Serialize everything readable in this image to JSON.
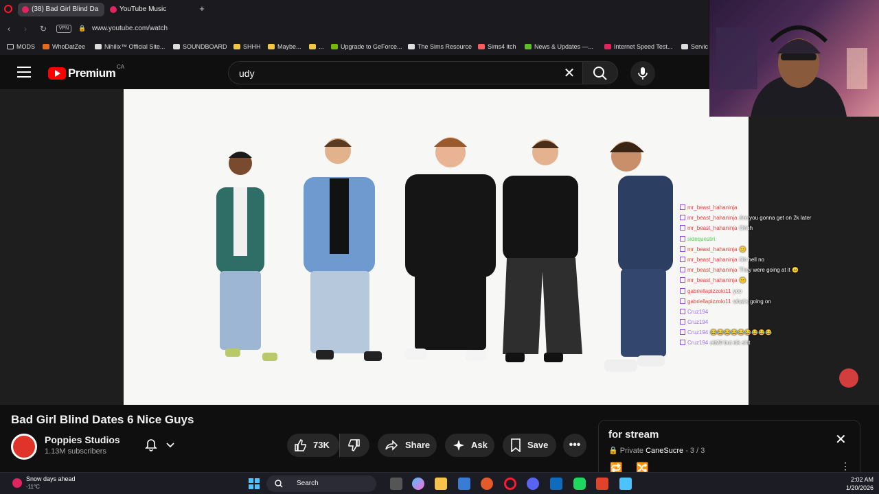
{
  "browser": {
    "tabs": [
      {
        "label": "(38) Bad Girl Blind Da"
      },
      {
        "label": "YouTube Music"
      }
    ],
    "url": "www.youtube.com/watch",
    "vpn_label": "VPN",
    "bookmarks": [
      "MODS",
      "WhoDatZee",
      "Nihilix™ Official Site...",
      "SOUNDBOARD",
      "SHHH",
      "Maybe...",
      "...",
      "Upgrade to GeForce...",
      "The Sims Resource",
      "Sims4 itch",
      "News & Updates —...",
      "Internet Speed Test...",
      "Servic"
    ]
  },
  "header": {
    "brand": "Premium",
    "country": "CA",
    "search_value": "udy"
  },
  "chat": [
    {
      "user": "mr_beast_hahaninja",
      "msg": "",
      "color": "#e8423f"
    },
    {
      "user": "mr_beast_hahaninja",
      "msg": "Are you gonna get on 2k later",
      "color": "#e8423f"
    },
    {
      "user": "mr_beast_hahaninja",
      "msg": "Ohhh",
      "color": "#e8423f"
    },
    {
      "user": "sidequestiri",
      "msg": "",
      "color": "#4fd14f"
    },
    {
      "user": "mr_beast_hahaninja",
      "msg": "😐",
      "color": "#e8423f"
    },
    {
      "user": "mr_beast_hahaninja",
      "msg": "Oh hell no",
      "color": "#e8423f"
    },
    {
      "user": "mr_beast_hahaninja",
      "msg": "They were going at it 😐",
      "color": "#e8423f"
    },
    {
      "user": "mr_beast_hahaninja",
      "msg": "😐",
      "color": "#e8423f"
    },
    {
      "user": "gabriellapizzolo11",
      "msg": "yoo",
      "color": "#e8423f"
    },
    {
      "user": "gabriellapizzolo11",
      "msg": "what's going on",
      "color": "#e8423f"
    },
    {
      "user": "Cruz194",
      "msg": "",
      "color": "#9b6bff"
    },
    {
      "user": "Cruz194",
      "msg": "",
      "color": "#9b6bff"
    },
    {
      "user": "Cruz194",
      "msg": "😂😂😂😂😂😂😂😂😂",
      "color": "#9b6bff"
    },
    {
      "user": "Cruz194",
      "msg": "eb20 but idk shit",
      "color": "#9b6bff"
    }
  ],
  "video": {
    "title": "Bad Girl Blind Dates 6 Nice Guys",
    "channel": "Poppies Studios",
    "subscribers": "1.13M subscribers",
    "likes": "73K",
    "share": "Share",
    "ask": "Ask",
    "save": "Save"
  },
  "playlist": {
    "title": "for stream",
    "privacy": "Private",
    "owner": "CaneSucre",
    "position": "3 / 3"
  },
  "taskbar": {
    "weather": "Snow days ahead",
    "temp": "-11°C",
    "search": "Search",
    "time": "2:02 AM",
    "date": "1/20/2026"
  }
}
